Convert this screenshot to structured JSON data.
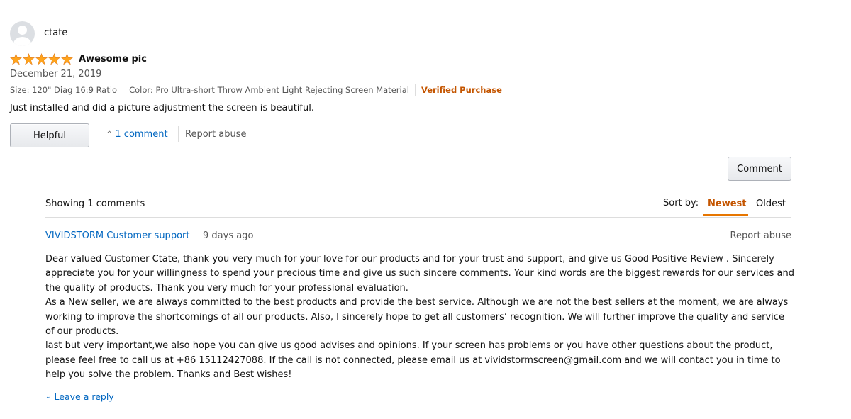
{
  "review": {
    "reviewer_name": "ctate",
    "rating": 5,
    "rating_max": 5,
    "title": "Awesome pic",
    "date": "December 21, 2019",
    "size": "Size: 120\" Diag 16:9 Ratio",
    "color": "Color: Pro Ultra-short Throw Ambient Light Rejecting Screen Material",
    "verified": "Verified Purchase",
    "body": "Just installed and did a picture adjustment the screen is beautiful.",
    "helpful_label": "Helpful",
    "comments_link": "1 comment",
    "report_abuse": "Report abuse"
  },
  "comments_section": {
    "comment_button": "Comment",
    "showing_text": "Showing 1 comments",
    "sort_label": "Sort by:",
    "sort_options": [
      "Newest",
      "Oldest"
    ],
    "sort_selected": "Newest",
    "colors": {
      "accent": "#c45500",
      "link": "#0066c0",
      "star": "#ffa41c"
    },
    "comment": {
      "author": "VIVIDSTORM Customer support",
      "age": "9 days ago",
      "report_abuse": "Report abuse",
      "paragraphs": [
        "Dear valued Customer Ctate, thank you very much for your love for our products and for your trust and support, and give us Good Positive Review . Sincerely",
        "appreciate you for your willingness to spend your precious time and give us such sincere comments. Your kind words are the biggest rewards for our services and",
        "the quality of products. Thank you very much for your professional evaluation.",
        "As a New seller, we are always committed to the best products and provide the best service. Although we are not the best sellers at the moment, we are always",
        "working to improve the shortcomings of all our products. Also, I sincerely hope to get all customers’ recognition. We will further improve the quality and service",
        "of our products.",
        "last but very important,we also hope you can give us good advises and opinions. If your screen has problems or you have other questions about the product,",
        "please feel free to call us at +86 15112427088. If the call is not connected, please email us at vividstormscreen@gmail.com and we will contact you in time to",
        "help you solve the problem. Thanks and Best wishes!"
      ]
    },
    "leave_reply": "Leave a reply"
  }
}
